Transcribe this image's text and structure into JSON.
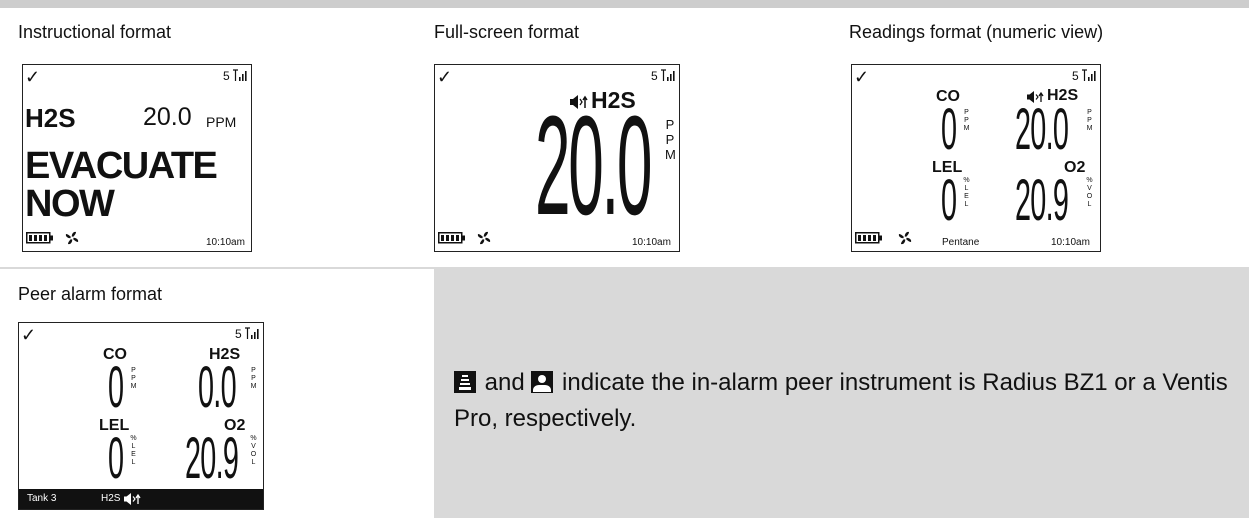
{
  "captions": {
    "instructional": "Instructional format",
    "fullscreen": "Full-screen format",
    "readings": "Readings format (numeric view)",
    "peer": "Peer alarm format"
  },
  "status": {
    "check": "✓",
    "signal_number": "5",
    "time": "10:10am"
  },
  "instructional": {
    "gas": "H2S",
    "value": "20.0",
    "unit": "PPM",
    "message_line1": "EVACUATE",
    "message_line2": "NOW"
  },
  "fullscreen": {
    "gas": "H2S",
    "value": "20.0",
    "unit_letters": [
      "P",
      "P",
      "M"
    ]
  },
  "readings": {
    "gas_bottom_label": "Pentane",
    "sensors": [
      {
        "gas": "CO",
        "value": "0",
        "unit": [
          "P",
          "P",
          "M"
        ]
      },
      {
        "gas": "H2S",
        "value": "20.0",
        "unit": [
          "P",
          "P",
          "M"
        ]
      },
      {
        "gas": "LEL",
        "value": "0",
        "unit": [
          "%",
          "L",
          "E",
          "L"
        ]
      },
      {
        "gas": "O2",
        "value": "20.9",
        "unit": [
          "%",
          "V",
          "O",
          "L"
        ]
      }
    ]
  },
  "peer": {
    "footer_name": "Tank 3",
    "footer_gas": "H2S",
    "sensors": [
      {
        "gas": "CO",
        "value": "0",
        "unit": [
          "P",
          "P",
          "M"
        ]
      },
      {
        "gas": "H2S",
        "value": "0.0",
        "unit": [
          "P",
          "P",
          "M"
        ]
      },
      {
        "gas": "LEL",
        "value": "0",
        "unit": [
          "%",
          "L",
          "E",
          "L"
        ]
      },
      {
        "gas": "O2",
        "value": "20.9",
        "unit": [
          "%",
          "V",
          "O",
          "L"
        ]
      }
    ]
  },
  "note": {
    "and": " and ",
    "text": " indicate the in-alarm peer instrument is Radius BZ1 or a Ventis Pro, respectively."
  }
}
